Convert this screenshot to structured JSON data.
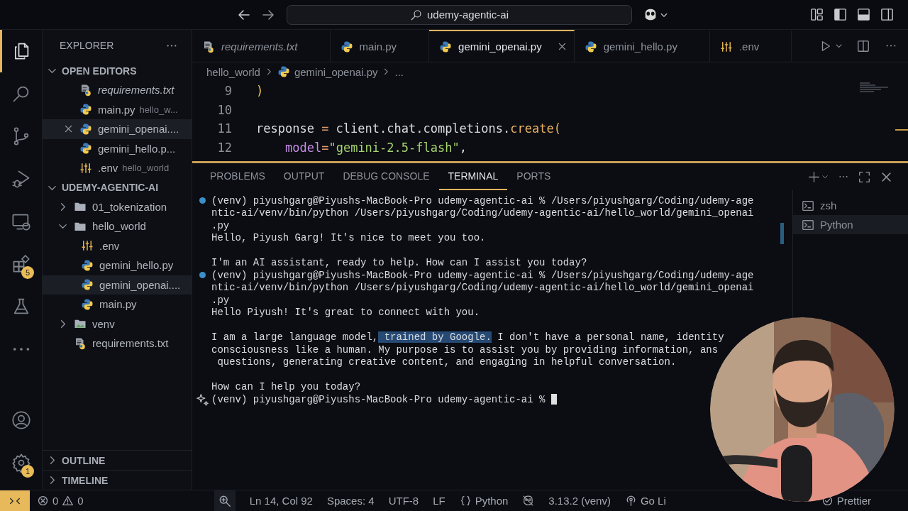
{
  "title_bar": {
    "search": "udemy-agentic-ai"
  },
  "activity_bar": {
    "items": [
      {
        "kind": "files",
        "selected": true
      },
      {
        "kind": "search",
        "selected": false
      },
      {
        "kind": "branch",
        "selected": false
      },
      {
        "kind": "debug",
        "selected": false
      },
      {
        "kind": "remote",
        "selected": false
      },
      {
        "kind": "extensions",
        "selected": false,
        "badge": "5"
      },
      {
        "kind": "flask",
        "selected": false
      },
      {
        "kind": "more",
        "selected": false
      }
    ],
    "bottom": [
      {
        "kind": "account"
      },
      {
        "kind": "settings",
        "badge": "1"
      }
    ]
  },
  "sidebar": {
    "title": "EXPLORER",
    "open_editors": {
      "title": "OPEN EDITORS",
      "expanded": true,
      "items": [
        {
          "name": "requirements.txt",
          "kind": "text",
          "preview": true,
          "selected": false
        },
        {
          "name": "main.py",
          "description": "hello_w...",
          "kind": "python",
          "preview": false,
          "selected": false
        },
        {
          "name": "gemini_openai....",
          "kind": "python",
          "preview": false,
          "selected": true
        },
        {
          "name": "gemini_hello.p...",
          "kind": "python",
          "preview": false,
          "selected": false
        },
        {
          "name": ".env",
          "description": "hello_world",
          "kind": "env",
          "preview": false,
          "selected": false
        }
      ]
    },
    "folder": {
      "title": "UDEMY-AGENTIC-AI",
      "expanded": true,
      "children": [
        {
          "name": "01_tokenization",
          "kind": "folder",
          "expanded": false,
          "selected": false
        },
        {
          "name": "hello_world",
          "kind": "folder",
          "expanded": true,
          "selected": false,
          "children": [
            {
              "name": ".env",
              "kind": "env",
              "selected": false
            },
            {
              "name": "gemini_hello.py",
              "kind": "python",
              "selected": false
            },
            {
              "name": "gemini_openai....",
              "kind": "python",
              "selected": true
            },
            {
              "name": "main.py",
              "kind": "python",
              "selected": false
            }
          ]
        },
        {
          "name": "venv",
          "kind": "venv",
          "expanded": false,
          "selected": false
        },
        {
          "name": "requirements.txt",
          "kind": "text",
          "selected": false
        }
      ]
    },
    "sections": [
      {
        "title": "OUTLINE",
        "expanded": false
      },
      {
        "title": "TIMELINE",
        "expanded": false
      }
    ]
  },
  "editor": {
    "tabs": [
      {
        "label": "requirements.txt",
        "kind": "text",
        "preview": true,
        "selected": false
      },
      {
        "label": "main.py",
        "kind": "python",
        "preview": false,
        "selected": false
      },
      {
        "label": "gemini_openai.py",
        "kind": "python",
        "preview": false,
        "selected": true
      },
      {
        "label": "gemini_hello.py",
        "kind": "python",
        "preview": false,
        "selected": false
      },
      {
        "label": ".env",
        "kind": "env",
        "preview": false,
        "selected": false
      }
    ],
    "breadcrumb": [
      {
        "text": "hello_world",
        "kind": "folder"
      },
      {
        "text": "gemini_openai.py",
        "kind": "python"
      },
      {
        "text": "...",
        "kind": "more"
      }
    ],
    "lines": [
      {
        "number": "9",
        "tokens": [
          {
            "text": ")",
            "kind": "paren"
          }
        ]
      },
      {
        "number": "10"
      },
      {
        "number": "11",
        "tokens": [
          {
            "text": "response ",
            "kind": "plain"
          },
          {
            "text": "=",
            "kind": "operator"
          },
          {
            "text": " client.chat.completions.",
            "kind": "plain"
          },
          {
            "text": "create(",
            "kind": "function"
          }
        ]
      },
      {
        "number": "12",
        "indented": true,
        "tokens": [
          {
            "text": "model",
            "kind": "param"
          },
          {
            "text": "=",
            "kind": "operator"
          },
          {
            "text": "\"gemini-2.5-flash\"",
            "kind": "string"
          },
          {
            "text": ",",
            "kind": "plain"
          }
        ]
      }
    ]
  },
  "panel": {
    "tabs": [
      {
        "label": "PROBLEMS",
        "selected": false
      },
      {
        "label": "OUTPUT",
        "selected": false
      },
      {
        "label": "DEBUG CONSOLE",
        "selected": false
      },
      {
        "label": "TERMINAL",
        "selected": true
      },
      {
        "label": "PORTS",
        "selected": false
      }
    ],
    "terminal": [
      {
        "kind": "prompt",
        "parts": [
          {
            "text": "(venv) piyushgarg@Piyushs-MacBook-Pro udemy-agentic-ai % /Users/piyushgarg/Coding/udemy-age",
            "selected": false
          }
        ]
      },
      {
        "kind": "text",
        "parts": [
          {
            "text": "ntic-ai/venv/bin/python /Users/piyushgarg/Coding/udemy-agentic-ai/hello_world/gemini_openai",
            "selected": false
          }
        ]
      },
      {
        "kind": "text",
        "parts": [
          {
            "text": ".py",
            "selected": false
          }
        ]
      },
      {
        "kind": "text",
        "parts": [
          {
            "text": "Hello, Piyush Garg! It's nice to meet you too.",
            "selected": false
          }
        ]
      },
      {
        "kind": "blank"
      },
      {
        "kind": "text",
        "parts": [
          {
            "text": "I'm an AI assistant, ready to help. How can I assist you today?",
            "selected": false
          }
        ]
      },
      {
        "kind": "prompt",
        "parts": [
          {
            "text": "(venv) piyushgarg@Piyushs-MacBook-Pro udemy-agentic-ai % /Users/piyushgarg/Coding/udemy-age",
            "selected": false
          }
        ]
      },
      {
        "kind": "text",
        "parts": [
          {
            "text": "ntic-ai/venv/bin/python /Users/piyushgarg/Coding/udemy-agentic-ai/hello_world/gemini_openai",
            "selected": false
          }
        ]
      },
      {
        "kind": "text",
        "parts": [
          {
            "text": ".py",
            "selected": false
          }
        ]
      },
      {
        "kind": "text",
        "parts": [
          {
            "text": "Hello Piyush! It's great to connect with you.",
            "selected": false
          }
        ]
      },
      {
        "kind": "blank"
      },
      {
        "kind": "text",
        "parts": [
          {
            "text": "I am a large language model,",
            "selected": false
          },
          {
            "text": " trained by Google.",
            "selected": true
          },
          {
            "text": " I don't have a personal name, identity",
            "selected": false
          }
        ]
      },
      {
        "kind": "text",
        "parts": [
          {
            "text": "consciousness like a human. My purpose is to assist you by providing information, ans",
            "selected": false
          }
        ]
      },
      {
        "kind": "text",
        "parts": [
          {
            "text": " questions, generating creative content, and engaging in helpful conversation.",
            "selected": false
          }
        ]
      },
      {
        "kind": "blank"
      },
      {
        "kind": "text",
        "parts": [
          {
            "text": "How can I help you today?",
            "selected": false
          }
        ]
      },
      {
        "kind": "ai_prompt",
        "cursor": true,
        "parts": [
          {
            "text": "(venv) piyushgarg@Piyushs-MacBook-Pro udemy-agentic-ai % ",
            "selected": false
          }
        ]
      }
    ],
    "terminals": [
      {
        "label": "zsh",
        "selected": false
      },
      {
        "label": "Python",
        "selected": true
      }
    ]
  },
  "status_bar": {
    "errors": "0",
    "warnings": "0",
    "items": [
      {
        "kind": "zoom"
      },
      {
        "kind": "text",
        "text": "Ln 14, Col 92"
      },
      {
        "kind": "text",
        "text": "Spaces: 4"
      },
      {
        "kind": "text",
        "text": "UTF-8"
      },
      {
        "kind": "text",
        "text": "LF"
      },
      {
        "kind": "braces",
        "text": "Python"
      },
      {
        "kind": "robot-off"
      },
      {
        "kind": "text",
        "text": "3.13.2 (venv)"
      },
      {
        "kind": "broadcast",
        "text": "Go Li"
      },
      {
        "kind": "check",
        "text": "Prettier"
      }
    ]
  }
}
